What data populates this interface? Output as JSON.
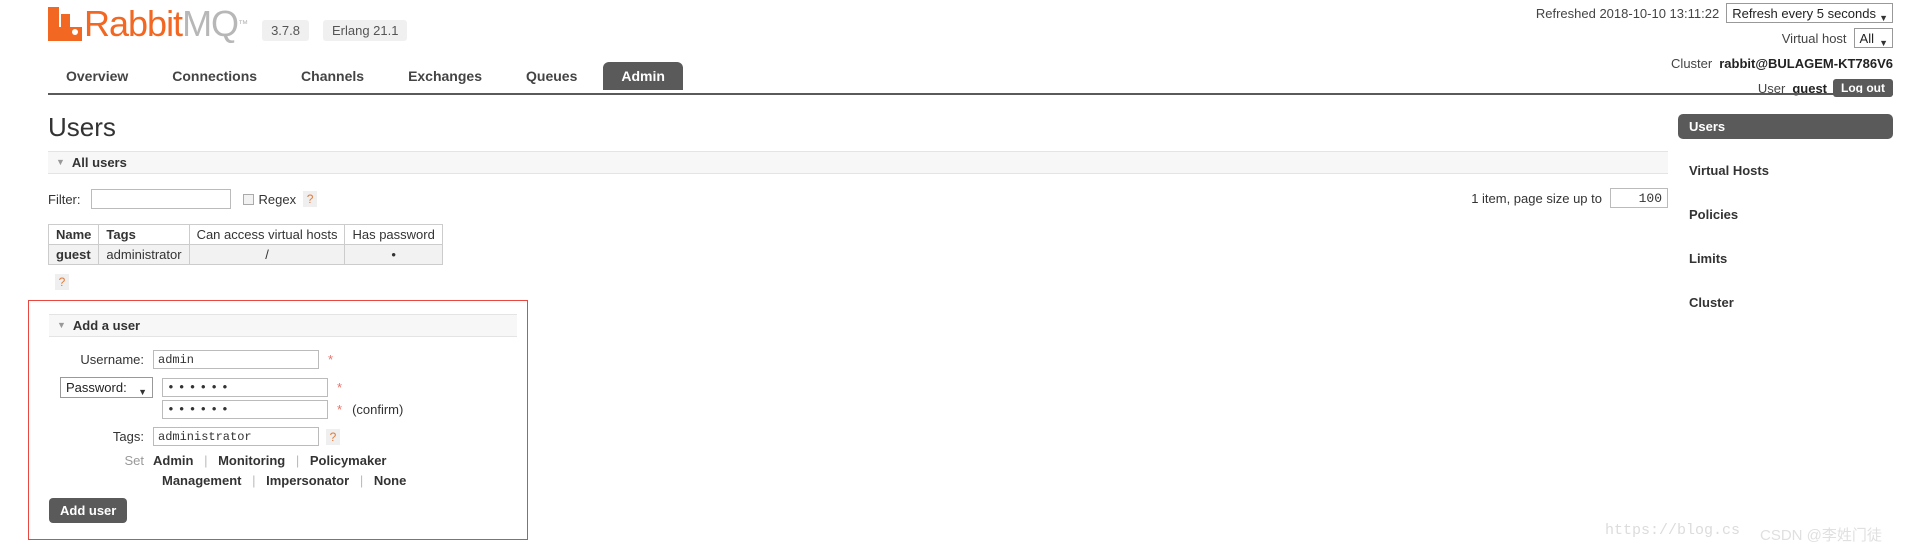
{
  "header": {
    "brand_rabbit": "Rabbit",
    "brand_mq": "MQ",
    "brand_tm": "™",
    "version": "3.7.8",
    "erlang": "Erlang 21.1",
    "refreshed_label": "Refreshed 2018-10-10 13:11:22",
    "refresh_select": "Refresh every 5 seconds",
    "vhost_label": "Virtual host",
    "vhost_value": "All",
    "cluster_label": "Cluster",
    "cluster_value": "rabbit@BULAGEM-KT786V6",
    "user_label": "User",
    "user_value": "guest",
    "logout_label": "Log out",
    "caret": "▼",
    "colors": {
      "brand": "#f26722",
      "accent": "#5a5a5a",
      "required": "#e8736b",
      "highlight_box": "#e8483f"
    }
  },
  "tabs": [
    {
      "label": "Overview",
      "active": false
    },
    {
      "label": "Connections",
      "active": false
    },
    {
      "label": "Channels",
      "active": false
    },
    {
      "label": "Exchanges",
      "active": false
    },
    {
      "label": "Queues",
      "active": false
    },
    {
      "label": "Admin",
      "active": true
    }
  ],
  "main": {
    "page_title": "Users",
    "all_users_section": "All users",
    "filter_label": "Filter:",
    "filter_value": "",
    "regex_label": "Regex",
    "help_mark": "?",
    "pager_text": "1 item, page size up to",
    "pager_value": "100",
    "table": {
      "columns": [
        "Name",
        "Tags",
        "Can access virtual hosts",
        "Has password"
      ],
      "rows": [
        {
          "name": "guest",
          "tags": "administrator",
          "vhosts": "/",
          "has_password": "•"
        }
      ]
    },
    "table_help": "?"
  },
  "add_user": {
    "section_title": "Add a user",
    "username_label": "Username:",
    "username_value": "admin",
    "password_select": "Password:",
    "password_value": "••••••",
    "password_confirm_value": "••••••",
    "confirm_note": "(confirm)",
    "required_mark": "*",
    "tags_label": "Tags:",
    "tags_value": "administrator",
    "tags_help": "?",
    "set_label": "Set",
    "tag_links_row1": [
      "Admin",
      "Monitoring",
      "Policymaker"
    ],
    "tag_links_row2": [
      "Management",
      "Impersonator",
      "None"
    ],
    "separator": "|",
    "submit_label": "Add user"
  },
  "sidebar": {
    "items": [
      {
        "label": "Users",
        "active": true
      },
      {
        "label": "Virtual Hosts",
        "active": false
      },
      {
        "label": "Policies",
        "active": false
      },
      {
        "label": "Limits",
        "active": false
      },
      {
        "label": "Cluster",
        "active": false
      }
    ]
  },
  "watermark": {
    "url": "https://blog.cs",
    "tag": "CSDN @李姓门徒"
  }
}
